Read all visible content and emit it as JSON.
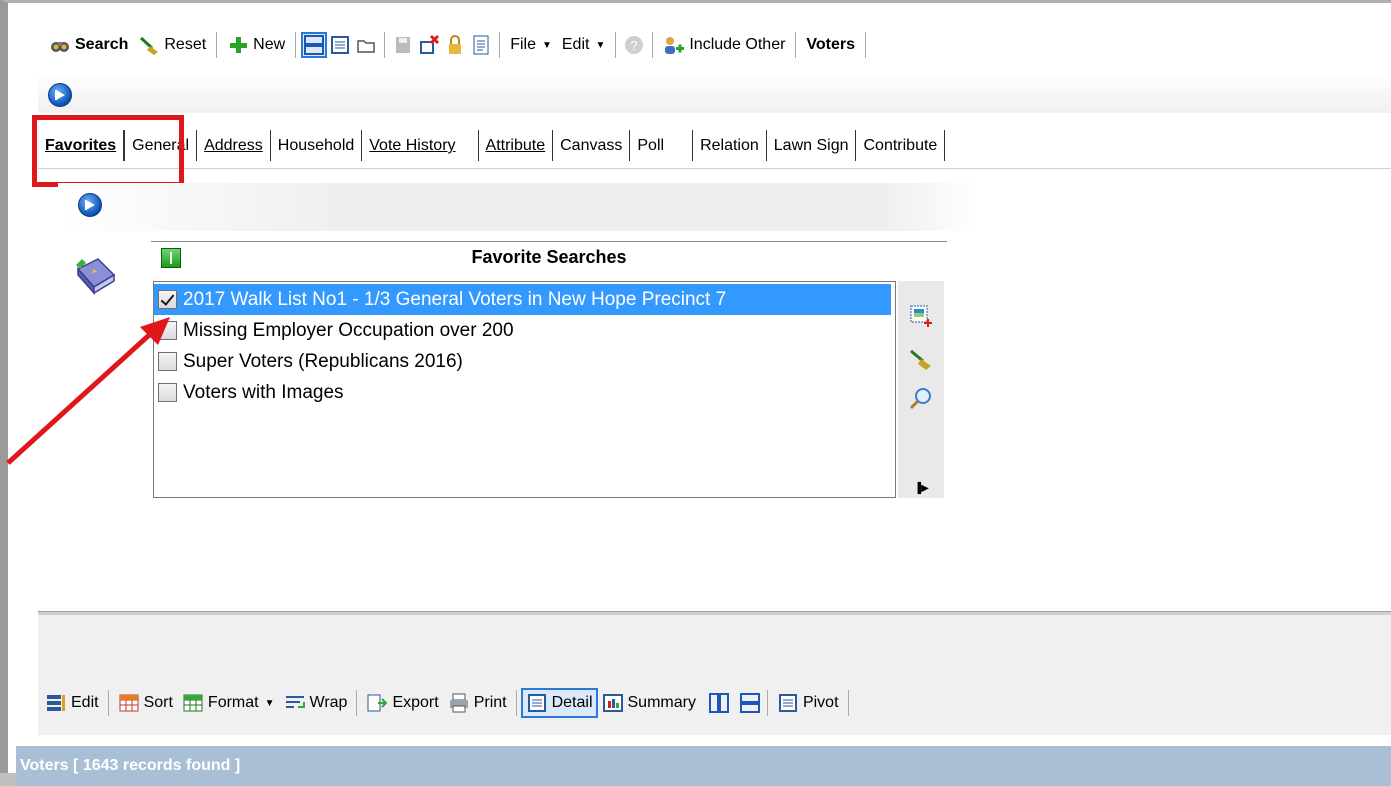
{
  "toolbar": {
    "search_label": "Search",
    "reset_label": "Reset",
    "new_label": "New",
    "file_label": "File",
    "edit_label": "Edit",
    "include_other_label": "Include Other",
    "voters_label": "Voters"
  },
  "tabs": [
    {
      "label": "Favorites"
    },
    {
      "label": "General"
    },
    {
      "label": "Address"
    },
    {
      "label": "Household"
    },
    {
      "label": "Vote History"
    },
    {
      "label": "Attribute"
    },
    {
      "label": "Canvass"
    },
    {
      "label": "Poll"
    },
    {
      "label": "Relation"
    },
    {
      "label": "Lawn Sign"
    },
    {
      "label": "Contribute"
    }
  ],
  "favorites": {
    "title": "Favorite Searches",
    "items": [
      {
        "label": "2017 Walk List No1 - 1/3 General Voters in New Hope Precinct 7",
        "checked": true
      },
      {
        "label": "Missing Employer Occupation over 200",
        "checked": false
      },
      {
        "label": "Super Voters (Republicans 2016)",
        "checked": false
      },
      {
        "label": "Voters with Images",
        "checked": false
      }
    ]
  },
  "bottom_toolbar": {
    "edit_label": "Edit",
    "sort_label": "Sort",
    "format_label": "Format",
    "wrap_label": "Wrap",
    "export_label": "Export",
    "print_label": "Print",
    "detail_label": "Detail",
    "summary_label": "Summary",
    "pivot_label": "Pivot"
  },
  "status": {
    "text": "Voters [ 1643 records found ]"
  },
  "colors": {
    "selection": "#3399ff",
    "callout": "#e0161b",
    "status_bar": "#a9bfd6"
  }
}
